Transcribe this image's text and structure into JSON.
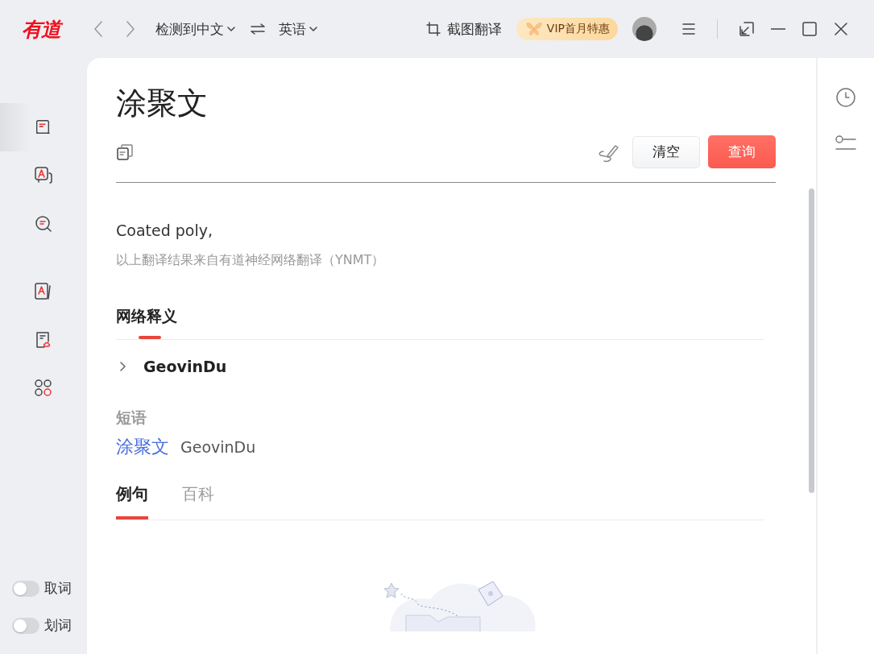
{
  "titlebar": {
    "logo": "有道",
    "source_language": "检测到中文",
    "target_language": "英语",
    "screenshot_translate": "截图翻译",
    "vip_offer": "VIP首月特惠"
  },
  "sidebar": {
    "items": [
      {
        "selected": true
      },
      {
        "selected": false
      },
      {
        "selected": false
      },
      {
        "selected": false
      },
      {
        "selected": false
      },
      {
        "selected": false
      }
    ],
    "toggles": [
      {
        "label": "取词",
        "on": false
      },
      {
        "label": "划词",
        "on": false
      }
    ]
  },
  "query": {
    "text": "涂聚文",
    "clear_button": "清空",
    "search_button": "查询"
  },
  "result": {
    "translation": "Coated poly,",
    "source_note": "以上翻译结果来自有道神经网络翻译（YNMT）"
  },
  "web_definitions": {
    "heading": "网络释义",
    "entries": [
      {
        "term": "GeovinDu",
        "expanded": false
      }
    ]
  },
  "phrases": {
    "heading": "短语",
    "items": [
      {
        "phrase": "涂聚文",
        "meaning": "GeovinDu"
      }
    ]
  },
  "tabs": [
    {
      "label": "例句",
      "selected": true
    },
    {
      "label": "百科",
      "selected": false
    }
  ]
}
